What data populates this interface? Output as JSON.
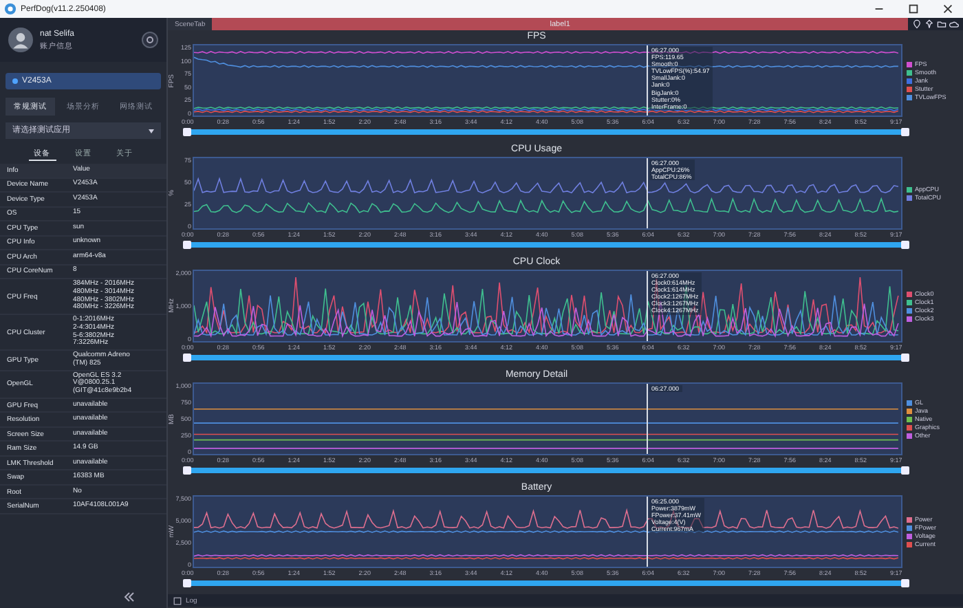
{
  "window": {
    "title": "PerfDog(v11.2.250408)"
  },
  "sidebar": {
    "user": {
      "name": "nat Selifa",
      "account_label": "账户信息"
    },
    "device": "V2453A",
    "mode_tabs": [
      {
        "label": "常规测试",
        "selected": true
      },
      {
        "label": "场景分析",
        "selected": false
      },
      {
        "label": "网络测试",
        "selected": false
      }
    ],
    "app_select": {
      "placeholder": "请选择测试应用"
    },
    "info_tabs": [
      {
        "label": "设备",
        "selected": true
      },
      {
        "label": "设置",
        "selected": false
      },
      {
        "label": "关于",
        "selected": false
      }
    ],
    "info_table": {
      "columns": [
        "Info",
        "Value"
      ],
      "rows": [
        {
          "label": "Device Name",
          "value": "V2453A"
        },
        {
          "label": "Device Type",
          "value": "V2453A"
        },
        {
          "label": "OS",
          "value": "15"
        },
        {
          "label": "CPU Type",
          "value": "sun"
        },
        {
          "label": "CPU Info",
          "value": "unknown"
        },
        {
          "label": "CPU Arch",
          "value": "arm64-v8a"
        },
        {
          "label": "CPU CoreNum",
          "value": "8"
        },
        {
          "label": "CPU Freq",
          "value": "384MHz - 2016MHz\n480MHz - 3014MHz\n480MHz - 3802MHz\n480MHz - 3226MHz"
        },
        {
          "label": "CPU Cluster",
          "value": "0-1:2016MHz\n2-4:3014MHz\n5-6:3802MHz\n7:3226MHz"
        },
        {
          "label": "GPU Type",
          "value": "Qualcomm Adreno\n(TM) 825"
        },
        {
          "label": "OpenGL",
          "value": "OpenGL ES 3.2\nV@0800.25.1\n(GIT@41c8e9b2b4"
        },
        {
          "label": "GPU Freq",
          "value": "unavailable"
        },
        {
          "label": "Resolution",
          "value": "unavailable"
        },
        {
          "label": "Screen Size",
          "value": "unavailable"
        },
        {
          "label": "Ram Size",
          "value": "14.9 GB"
        },
        {
          "label": "LMK Threshold",
          "value": "unavailable"
        },
        {
          "label": "Swap",
          "value": "16383 MB"
        },
        {
          "label": "Root",
          "value": "No"
        },
        {
          "label": "SerialNum",
          "value": "10AF4108L001A9"
        }
      ]
    }
  },
  "main": {
    "scene_tab": "SceneTab",
    "label_bar": "label1",
    "charts": [
      {
        "title": "FPS",
        "y_label": "FPS",
        "y_ticks": [
          "125",
          "100",
          "75",
          "50",
          "25",
          "0"
        ],
        "tooltip": [
          "06:27.000",
          "FPS:119.65",
          "Smooth:0",
          "TVLowFPS(%):54.97",
          "SmallJank:0",
          "Jank:0",
          "BigJank:0",
          "Stutter:0%",
          "InterFrame:0"
        ],
        "x_ticks": [
          "0:00",
          "0:28",
          "0:56",
          "1:24",
          "1:52",
          "2:20",
          "2:48",
          "3:16",
          "3:44",
          "4:12",
          "4:40",
          "5:08",
          "5:36",
          "6:04",
          "6:32",
          "7:00",
          "7:28",
          "7:56",
          "8:24",
          "8:52",
          "9:17"
        ],
        "zoom_range": {
          "level": 1
        },
        "legend": [
          {
            "name": "FPS",
            "color": "#d04fd0"
          },
          {
            "name": "Smooth",
            "color": "#3fbf8f"
          },
          {
            "name": "Jank",
            "color": "#3f6fdf"
          },
          {
            "name": "Stutter",
            "color": "#df4f4f"
          },
          {
            "name": "TVLowFPS",
            "color": "#4f8fdf"
          }
        ]
      },
      {
        "title": "CPU Usage",
        "y_label": "%",
        "y_ticks": [
          "75",
          "50",
          "25",
          "0"
        ],
        "tooltip": [
          "06:27.000",
          "AppCPU:26%",
          "TotalCPU:86%"
        ],
        "x_ticks": [
          "0:00",
          "0:28",
          "0:56",
          "1:24",
          "1:52",
          "2:20",
          "2:48",
          "3:16",
          "3:44",
          "4:12",
          "4:40",
          "5:08",
          "5:36",
          "6:04",
          "6:32",
          "7:00",
          "7:28",
          "7:56",
          "8:24",
          "8:52",
          "9:17"
        ],
        "zoom_range": {
          "level": 1
        },
        "legend": [
          {
            "name": "AppCPU",
            "color": "#3fbf8f"
          },
          {
            "name": "TotalCPU",
            "color": "#6f7fdf"
          }
        ]
      },
      {
        "title": "CPU Clock",
        "y_label": "MHz",
        "y_ticks": [
          "2,000",
          "1,000",
          "0"
        ],
        "tooltip": [
          "06:27.000",
          "Clock0:614MHz",
          "Clock1:614MHz",
          "Clock2:1267MHz",
          "Clock3:1267MHz",
          "Clock4:1267MHz"
        ],
        "x_ticks": [
          "0:00",
          "0:28",
          "0:56",
          "1:24",
          "1:52",
          "2:20",
          "2:48",
          "3:16",
          "3:44",
          "4:12",
          "4:40",
          "5:08",
          "5:36",
          "6:04",
          "6:32",
          "7:00",
          "7:28",
          "7:56",
          "8:24",
          "8:52",
          "9:17"
        ],
        "zoom_range": {
          "level": 1
        },
        "legend": [
          {
            "name": "Clock0",
            "color": "#df4f6f"
          },
          {
            "name": "Clock1",
            "color": "#3fbf8f"
          },
          {
            "name": "Clock2",
            "color": "#4f8fdf"
          },
          {
            "name": "Clock3",
            "color": "#bf5fdf"
          }
        ]
      },
      {
        "title": "Memory Detail",
        "y_label": "MB",
        "y_ticks": [
          "1,000",
          "750",
          "500",
          "250",
          "0"
        ],
        "tooltip": [
          "06:27.000"
        ],
        "x_ticks": [
          "0:00",
          "0:28",
          "0:56",
          "1:24",
          "1:52",
          "2:20",
          "2:48",
          "3:16",
          "3:44",
          "4:12",
          "4:40",
          "5:08",
          "5:36",
          "6:04",
          "6:32",
          "7:00",
          "7:28",
          "7:56",
          "8:24",
          "8:52",
          "9:17"
        ],
        "zoom_range": {
          "level": 1
        },
        "legend": [
          {
            "name": "GL",
            "color": "#4f8fdf"
          },
          {
            "name": "Java",
            "color": "#df8f3f"
          },
          {
            "name": "Native",
            "color": "#6fbf4f"
          },
          {
            "name": "Graphics",
            "color": "#df4f4f"
          },
          {
            "name": "Other",
            "color": "#bf5fdf"
          }
        ]
      },
      {
        "title": "Battery",
        "y_label": "mW",
        "y_ticks": [
          "7,500",
          "5,000",
          "2,500",
          "0"
        ],
        "tooltip": [
          "06:25.000",
          "Power:3879mW",
          "FPower:37.41mW",
          "Voltage:4(V)",
          "Current:967mA"
        ],
        "x_ticks": [
          "0:00",
          "0:28",
          "0:56",
          "1:24",
          "1:52",
          "2:20",
          "2:48",
          "3:16",
          "3:44",
          "4:12",
          "4:40",
          "5:08",
          "5:36",
          "6:04",
          "6:32",
          "7:00",
          "7:28",
          "7:56",
          "8:24",
          "8:52",
          "9:17"
        ],
        "zoom_range": {
          "level": 1
        },
        "legend": [
          {
            "name": "Power",
            "color": "#df6f8f"
          },
          {
            "name": "FPower",
            "color": "#4f8fdf"
          },
          {
            "name": "Voltage",
            "color": "#bf5fdf"
          },
          {
            "name": "Current",
            "color": "#df4f4f"
          }
        ]
      }
    ],
    "log_label": "Log"
  }
}
